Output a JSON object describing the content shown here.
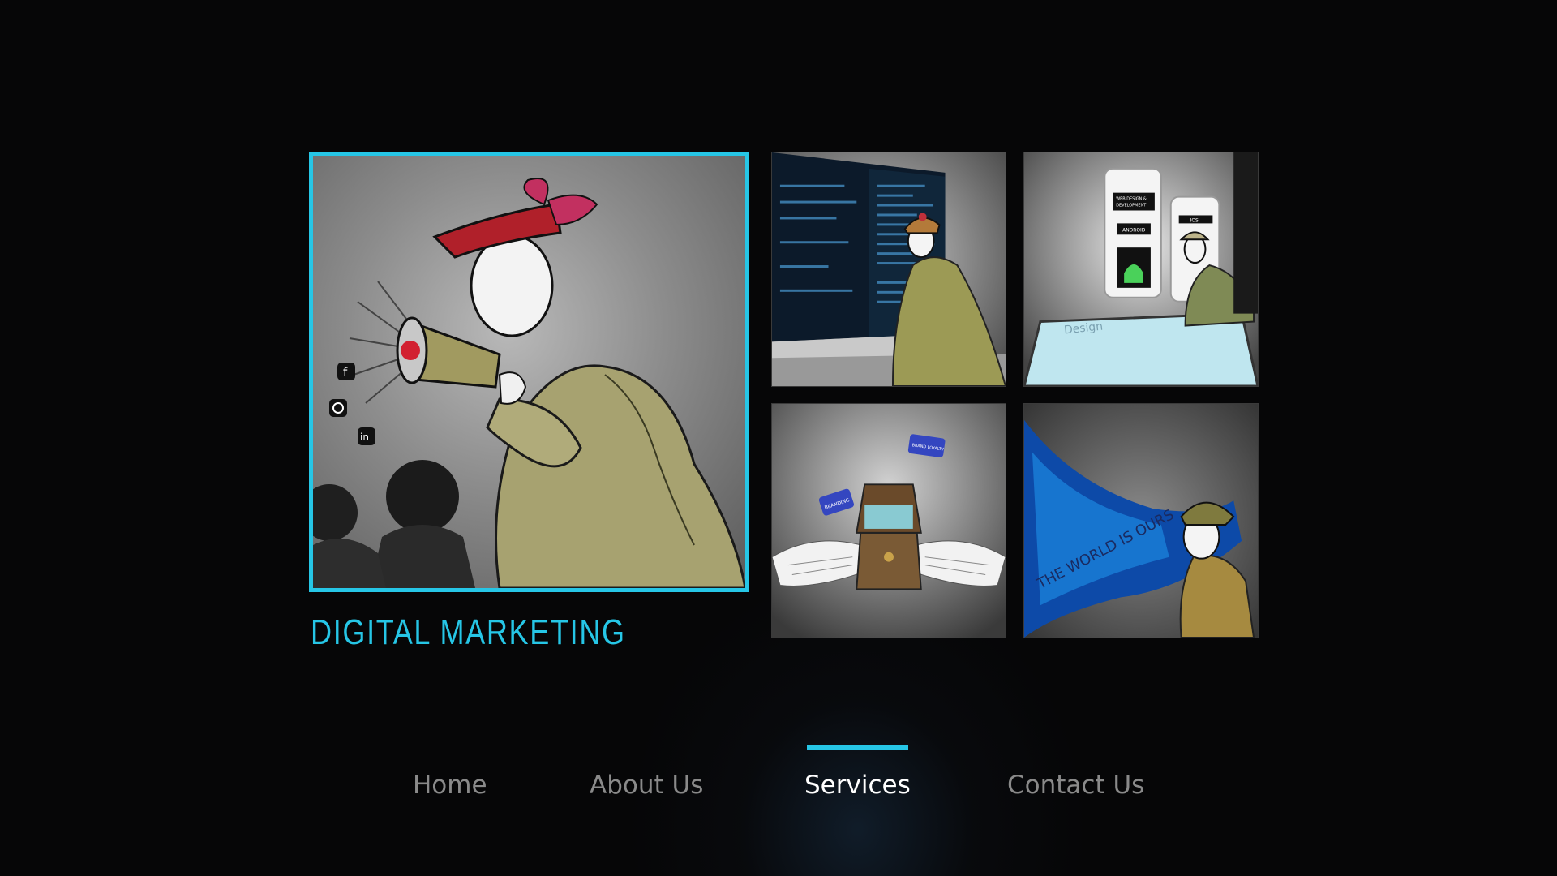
{
  "services": {
    "featured_title": "DIGITAL MARKETING",
    "featured_image_text": [
      "f",
      "in"
    ],
    "thumb_web_text": [
      "WEB DESIGN &",
      "DEVELOPMENT",
      "ANDROID",
      "IOS",
      "Design"
    ],
    "thumb_brand_text": [
      "BRANDING",
      "BRAND LOYALTY"
    ],
    "thumb_world_text": "THE WORLD IS OURS"
  },
  "nav": {
    "items": [
      {
        "label": "Home",
        "active": false
      },
      {
        "label": "About Us",
        "active": false
      },
      {
        "label": "Services",
        "active": true
      },
      {
        "label": "Contact Us",
        "active": false
      }
    ]
  },
  "colors": {
    "accent": "#26c6e6",
    "background": "#060607",
    "nav_inactive": "#8a8a8a",
    "nav_active": "#ffffff"
  }
}
